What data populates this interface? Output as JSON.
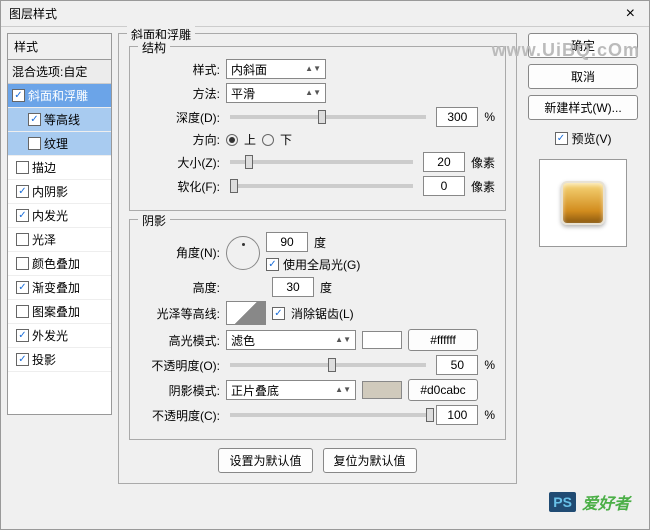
{
  "title": "图层样式",
  "close": "×",
  "left": {
    "header": "样式",
    "blend": "混合选项:自定",
    "items": [
      {
        "label": "斜面和浮雕",
        "checked": true,
        "selected": true
      },
      {
        "label": "等高线",
        "checked": true,
        "sub": true,
        "subselected": true
      },
      {
        "label": "纹理",
        "checked": false,
        "sub": true,
        "subselected": true
      },
      {
        "label": "描边",
        "checked": false
      },
      {
        "label": "内阴影",
        "checked": true
      },
      {
        "label": "内发光",
        "checked": true
      },
      {
        "label": "光泽",
        "checked": false
      },
      {
        "label": "颜色叠加",
        "checked": false
      },
      {
        "label": "渐变叠加",
        "checked": true
      },
      {
        "label": "图案叠加",
        "checked": false
      },
      {
        "label": "外发光",
        "checked": true
      },
      {
        "label": "投影",
        "checked": true
      }
    ]
  },
  "panel": {
    "title": "斜面和浮雕",
    "structure": {
      "legend": "结构",
      "style_label": "样式:",
      "style_value": "内斜面",
      "method_label": "方法:",
      "method_value": "平滑",
      "depth_label": "深度(D):",
      "depth_value": "300",
      "depth_unit": "%",
      "direction_label": "方向:",
      "direction_up": "上",
      "direction_down": "下",
      "size_label": "大小(Z):",
      "size_value": "20",
      "size_unit": "像素",
      "soften_label": "软化(F):",
      "soften_value": "0",
      "soften_unit": "像素"
    },
    "shading": {
      "legend": "阴影",
      "angle_label": "角度(N):",
      "angle_value": "90",
      "angle_unit": "度",
      "global_light": "使用全局光(G)",
      "altitude_label": "高度:",
      "altitude_value": "30",
      "altitude_unit": "度",
      "gloss_label": "光泽等高线:",
      "antialias": "消除锯齿(L)",
      "highlight_mode_label": "高光模式:",
      "highlight_mode_value": "滤色",
      "highlight_color": "#ffffff",
      "highlight_opacity_label": "不透明度(O):",
      "highlight_opacity_value": "50",
      "highlight_opacity_unit": "%",
      "shadow_mode_label": "阴影模式:",
      "shadow_mode_value": "正片叠底",
      "shadow_color": "#d0cabc",
      "shadow_opacity_label": "不透明度(C):",
      "shadow_opacity_value": "100",
      "shadow_opacity_unit": "%"
    },
    "make_default": "设置为默认值",
    "reset_default": "复位为默认值"
  },
  "right": {
    "ok": "确定",
    "cancel": "取消",
    "new_style": "新建样式(W)...",
    "preview": "预览(V)"
  },
  "watermark": {
    "ps": "PS",
    "txt": "爱好者",
    "url": "www.UiBQ.cOm"
  }
}
